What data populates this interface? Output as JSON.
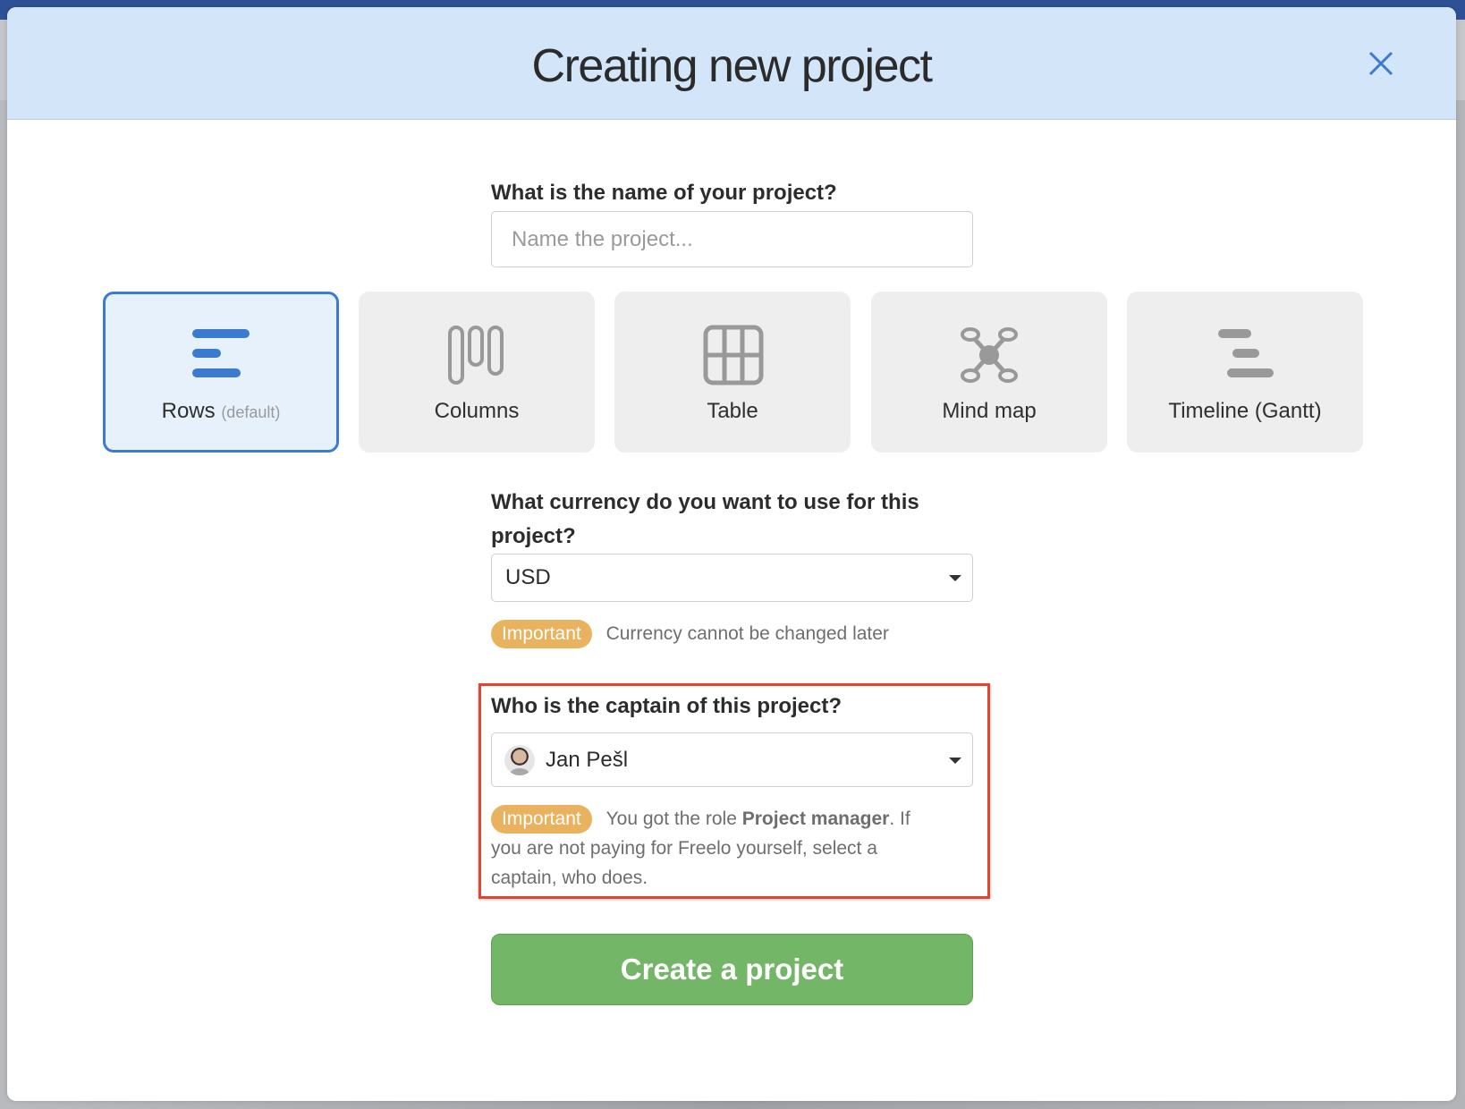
{
  "modal": {
    "title": "Creating new project",
    "close_icon": "close-icon"
  },
  "project_name": {
    "label": "What is the name of your project?",
    "placeholder": "Name the project...",
    "value": ""
  },
  "views": [
    {
      "label": "Rows",
      "sub": "(default)",
      "icon": "rows-icon",
      "selected": true
    },
    {
      "label": "Columns",
      "sub": "",
      "icon": "columns-icon",
      "selected": false
    },
    {
      "label": "Table",
      "sub": "",
      "icon": "table-icon",
      "selected": false
    },
    {
      "label": "Mind map",
      "sub": "",
      "icon": "mind-map-icon",
      "selected": false
    },
    {
      "label": "Timeline (Gantt)",
      "sub": "",
      "icon": "timeline-gantt-icon",
      "selected": false
    }
  ],
  "currency": {
    "label_line1": "What currency do you want to use for this",
    "label_line2": "project?",
    "selected": "USD",
    "badge": "Important",
    "note": "Currency cannot be changed later"
  },
  "captain": {
    "label": "Who is the captain of this project?",
    "selected": "Jan Pešl",
    "badge": "Important",
    "note_prefix": "You got the role ",
    "note_role": "Project manager",
    "note_suffix": ". If",
    "note_line2": "you are not paying for Freelo yourself, select a",
    "note_line3": "captain, who does."
  },
  "actions": {
    "create_label": "Create a project"
  },
  "colors": {
    "header_bg": "#d3e5f9",
    "accent_blue": "#3a7bd0",
    "important_badge": "#e9b25e",
    "create_button": "#74b667",
    "highlight_border": "#e2452f",
    "topbar": "#2e5096"
  }
}
